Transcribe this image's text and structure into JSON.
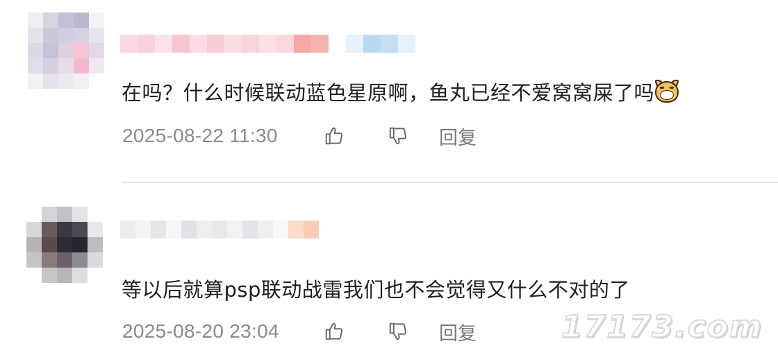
{
  "comments": [
    {
      "text": "在吗？什么时候联动蓝色星原啊，鱼丸已经不爱窝窝屎了吗",
      "emoji": "dog-face-emoji",
      "date": "2025-08-22 11:30",
      "reply_label": "回复"
    },
    {
      "text": "等以后就算psp联动战雷我们也不会觉得又什么不对的了",
      "date": "2025-08-20 23:04",
      "reply_label": "回复"
    }
  ],
  "icons": {
    "like": "thumbs-up-icon",
    "dislike": "thumbs-down-icon"
  },
  "watermark": "17173.com",
  "colors": {
    "meta": "#8a8a8a",
    "divider": "#e6e6e6",
    "text": "#1f1f1f"
  }
}
